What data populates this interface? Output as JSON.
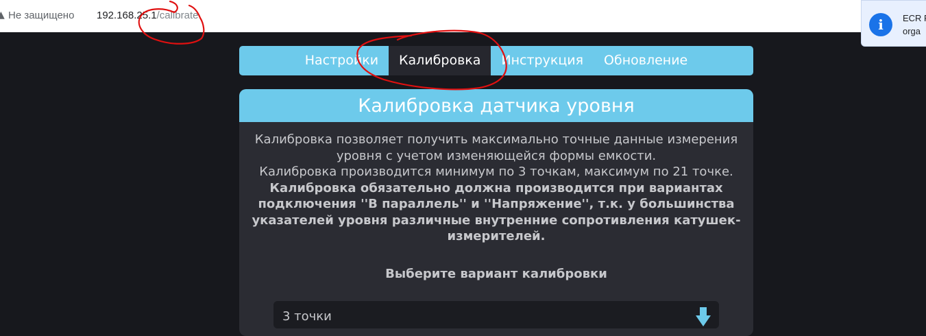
{
  "browser": {
    "security_label": "Не защищено",
    "url_host": "192.168.25.1",
    "url_path": "/calibrate",
    "notification_text_1": "ECR F",
    "notification_text_2": "orga"
  },
  "nav": {
    "items": [
      {
        "label": "Настройки"
      },
      {
        "label": "Калибровка"
      },
      {
        "label": "Инструкция"
      },
      {
        "label": "Обновление"
      }
    ],
    "active": "Калибровка"
  },
  "card": {
    "title": "Калибровка датчика уровня",
    "desc_1": "Калибровка позволяет получить максимально точные данные измерения уровня с учетом изменяющейся формы емкости.",
    "desc_2": "Калибровка производится минимум по 3 точкам, максимум по 21 точке.",
    "desc_bold": "Калибровка обязательно должна производится при вариантах подключения ''В параллель'' и ''Напряжение'', т.к. у большинства указателей уровня различные внутренние сопротивления катушек-измерителей.",
    "choose_label": "Выберите вариант калибровки",
    "select_value": "3 точки"
  },
  "colors": {
    "accent": "#6dcaeb",
    "active_tab": "#26272e",
    "background": "#17181d",
    "card": "#2b2c33",
    "annotation": "#e01010"
  }
}
